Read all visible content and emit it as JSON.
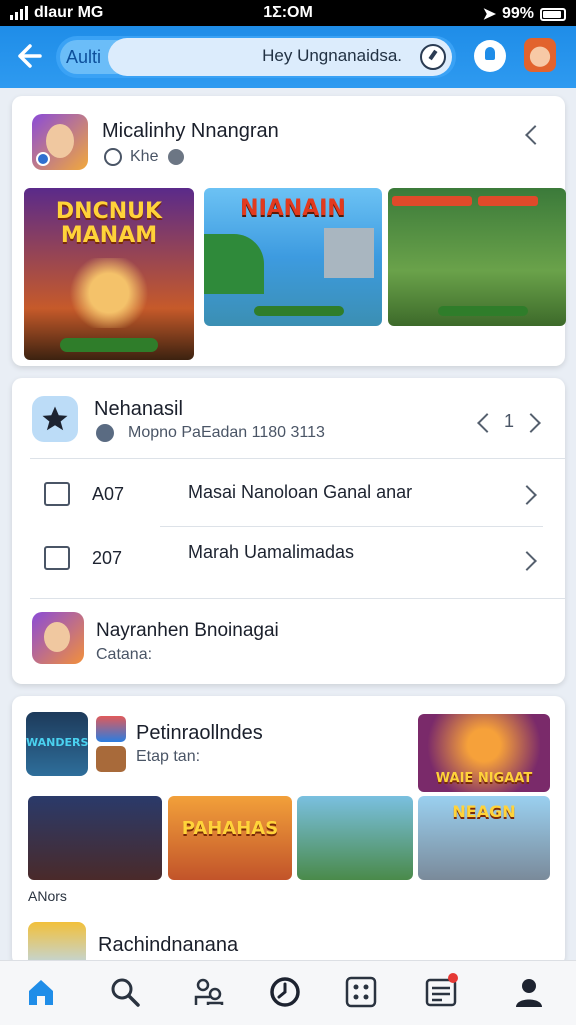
{
  "status": {
    "carrier": "dΙaur MG",
    "time": "1Σ:OM",
    "battery": "99%"
  },
  "header": {
    "chip_label": "Aulti",
    "search_placeholder": "Hey Ungnanaidsa.",
    "icons": [
      "back-arrow-icon",
      "refresh-icon",
      "bell-icon",
      "avatar"
    ]
  },
  "card1": {
    "title": "Micalinhy Nnangran",
    "subtitle": "Khe",
    "thumbs": [
      {
        "label": "DNCNUK MANAM",
        "footer": ""
      },
      {
        "label": "NIANAIN"
      },
      {
        "label": ""
      }
    ]
  },
  "card2": {
    "header_title": "Nehanasil",
    "header_sub": "Mopno PaEadan 1180  3113",
    "page_num": "1",
    "rows": [
      {
        "num": "A07",
        "label": "Masai Nanoloan Ganal anar"
      },
      {
        "num": "207",
        "label": "Marah Uamalimadas"
      }
    ],
    "app_title": "Nayranhen Bnoinagai",
    "app_sub": "Catana:"
  },
  "card3": {
    "title": "Petinraollndes",
    "subtitle": "Etap tan:",
    "section_label": "ANors",
    "bottom_title": "Rachindnanana",
    "thumbs": [
      "WANDERS",
      "WAIE NIGAAT",
      "",
      "PAHAHAS",
      "",
      "NEAGN"
    ]
  },
  "nav": {
    "items": [
      "home-icon",
      "search-icon",
      "people-icon",
      "clock-icon",
      "grid-icon",
      "news-icon",
      "profile-icon"
    ]
  },
  "colors": {
    "accent": "#1f8de8",
    "notif": "#e53935"
  }
}
